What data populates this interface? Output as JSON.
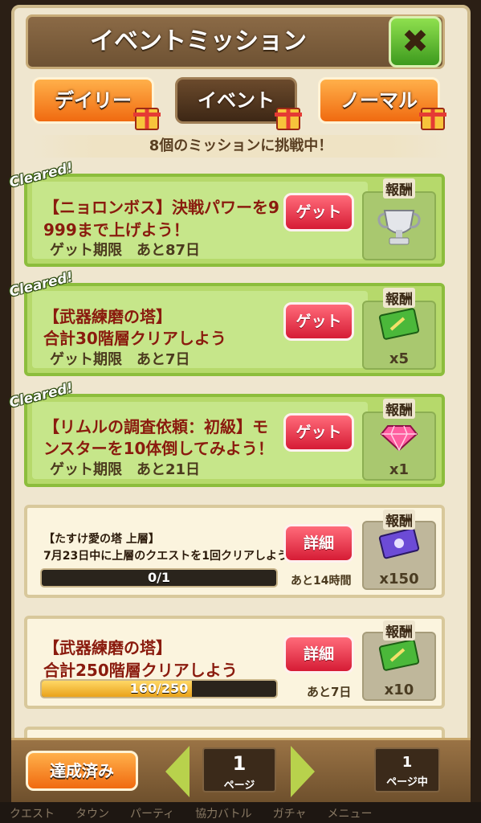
{
  "header": {
    "title": "イベントミッション",
    "close_icon": "close-x-icon"
  },
  "tabs": [
    {
      "label": "デイリー",
      "active": false,
      "gift": true
    },
    {
      "label": "イベント",
      "active": true,
      "gift": true
    },
    {
      "label": "ノーマル",
      "active": false,
      "gift": true
    }
  ],
  "summary": "8個のミッションに挑戦中！",
  "reward_header": "報酬",
  "missions": [
    {
      "status": "Cleared!",
      "title_line1": "【ニョロンボス】決戦パワーを9",
      "title_line2": "999まで上げよう！",
      "deadline": "ゲット期限　あと87日",
      "button": "ゲット",
      "reward_icon": "silver-trophy-icon",
      "reward_count": ""
    },
    {
      "status": "Cleared!",
      "title_line1": "【武器練磨の塔】",
      "title_line2": "合計30階層クリアしよう",
      "deadline": "ゲット期限　あと7日",
      "button": "ゲット",
      "reward_icon": "green-ticket-icon",
      "reward_count": "x5"
    },
    {
      "status": "Cleared!",
      "title_line1": "【リムルの調査依頼：初級】モ",
      "title_line2": "ンスターを10体倒してみよう！",
      "deadline": "ゲット期限　あと21日",
      "button": "ゲット",
      "reward_icon": "pink-gem-icon",
      "reward_count": "x1"
    },
    {
      "status": "",
      "title_line1": "【たすけ愛の塔 上層】",
      "title_line2": "7月23日中に上層のクエストを1回クリアしよう",
      "progress_text": "0/1",
      "progress": 0.0,
      "time_left": "あと14時間",
      "button": "詳細",
      "reward_icon": "purple-ticket-icon",
      "reward_count": "x150"
    },
    {
      "status": "",
      "title_line1": "【武器練磨の塔】",
      "title_line2": "合計250階層クリアしよう",
      "progress_text": "160/250",
      "progress": 0.64,
      "time_left": "あと7日",
      "button": "詳細",
      "reward_icon": "green-ticket-icon",
      "reward_count": "x10"
    }
  ],
  "footer": {
    "done_button": "達成済み",
    "page_current": "1",
    "page_label": "ページ",
    "page_total": "1",
    "page_total_label": "ページ中"
  },
  "bottom_nav": [
    "クエスト",
    "タウン",
    "パーティ",
    "協力バトル",
    "ガチャ",
    "メニュー"
  ],
  "colors": {
    "accent_orange": "#f06a10",
    "cleared_green": "#b6d96b",
    "button_red": "#d61c35",
    "title_brown": "#6e5233",
    "progress_gold": "#e9a21b"
  }
}
